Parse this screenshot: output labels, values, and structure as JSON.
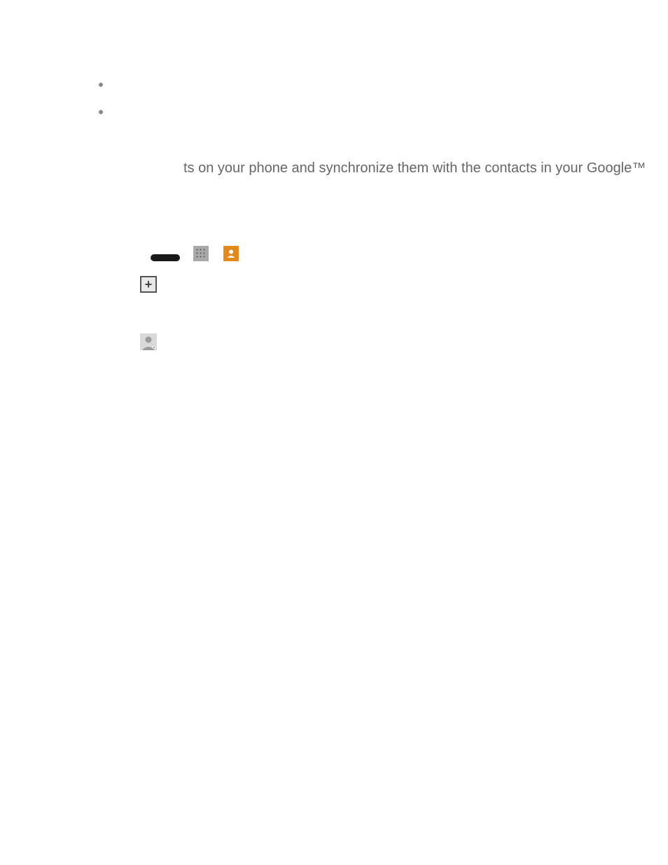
{
  "text_fragment": "ts on your phone and synchronize them with the contacts in your Google™",
  "icons": {
    "grid": "app-grid-icon",
    "contacts": "contacts-app-icon",
    "add": "add-contact-icon",
    "placeholder": "contact-silhouette-icon"
  }
}
